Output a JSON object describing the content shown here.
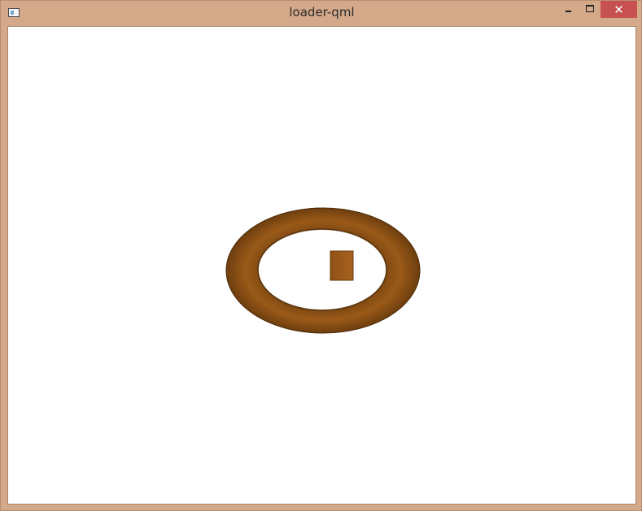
{
  "window": {
    "title": "loader-qml",
    "close_glyph": "✕"
  },
  "icons": {
    "app": "app-icon",
    "minimize": "minimize-icon",
    "maximize": "maximize-icon",
    "close": "close-icon"
  },
  "colors": {
    "frame": "#d4a98a",
    "close_button": "#c75050",
    "object_orange": "#8f5214",
    "background": "#ffffff"
  }
}
